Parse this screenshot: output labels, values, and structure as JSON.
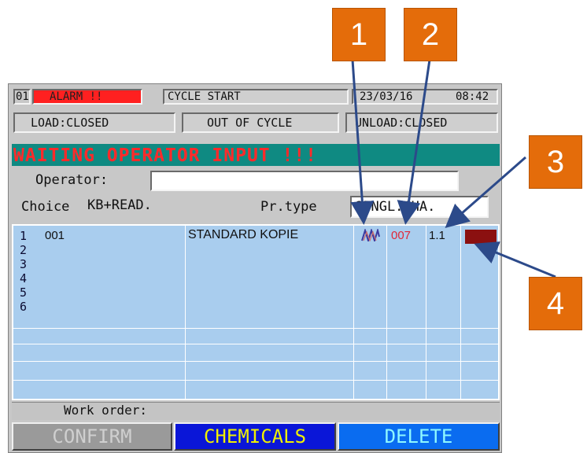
{
  "hmi": {
    "alarm_number": "01",
    "alarm_label": "ALARM !!",
    "cycle_status": "CYCLE START",
    "date": "23/03/16",
    "time": "08:42",
    "load_status": "LOAD:CLOSED",
    "cycle_state": "OUT OF CYCLE",
    "unload_status": "UNLOAD:CLOSED",
    "banner": "WAITING OPERATOR INPUT !!!",
    "operator_label": "Operator:",
    "operator_value": "",
    "choice_label": "Choice",
    "choice_value": "KB+READ.",
    "prtype_label": "Pr.type",
    "prtype_value": "SINGL.CHA.",
    "rows": [
      {
        "num": "1",
        "code": "001",
        "name": "STANDARD KOPIE",
        "program": "007",
        "version": "1.1",
        "color": "#8b1010"
      },
      {
        "num": "2"
      },
      {
        "num": "3"
      },
      {
        "num": "4"
      },
      {
        "num": "5"
      },
      {
        "num": "6"
      }
    ],
    "work_order_label": "Work order:",
    "buttons": {
      "confirm": "CONFIRM",
      "chemicals": "CHEMICALS",
      "delete": "DELETE"
    }
  },
  "callouts": [
    "1",
    "2",
    "3",
    "4"
  ],
  "colors": {
    "callout": "#e46c0a",
    "alarm": "#ff2020",
    "banner_bg": "#0f8a82",
    "banner_text": "#ff2a2a",
    "grid": "#a9cdee"
  },
  "icons": {
    "row1_type": "profile-wave-icon"
  }
}
